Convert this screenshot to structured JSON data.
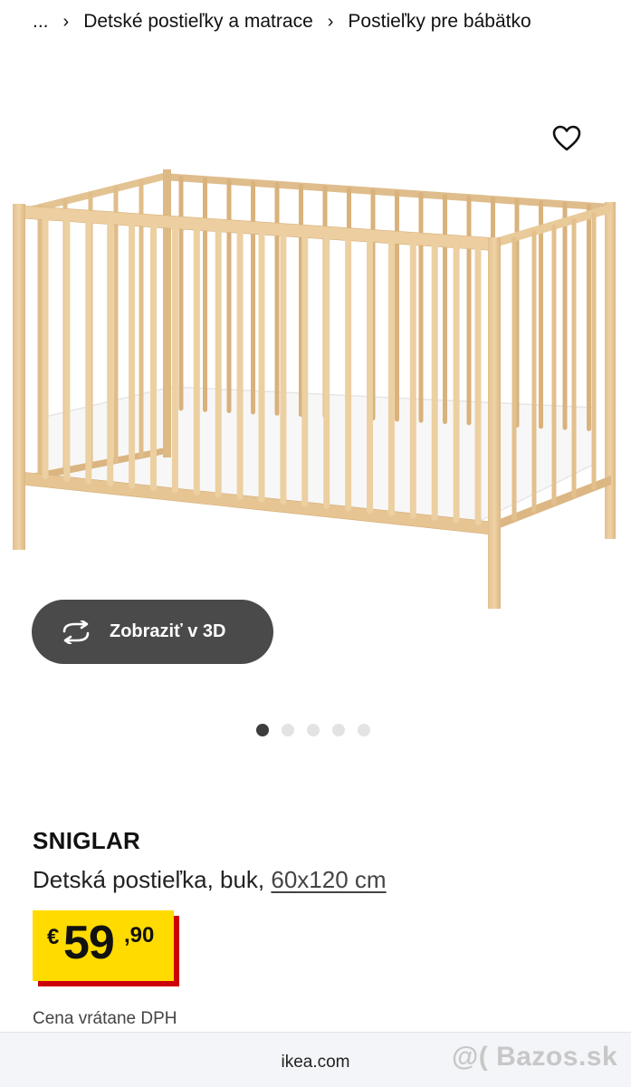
{
  "breadcrumb": {
    "items": [
      "...",
      "Detské postieľky a matrace",
      "Postieľky pre bábätko"
    ]
  },
  "view_3d": {
    "label": "Zobraziť v 3D"
  },
  "carousel": {
    "slides": 5,
    "active_index": 0
  },
  "product": {
    "name": "SNIGLAR",
    "description": "Detská postieľka, buk,",
    "size": "60x120 cm",
    "price": {
      "currency": "€",
      "integer": "59",
      "decimal": ",90"
    },
    "vat_note": "Cena vrátane DPH"
  },
  "browser": {
    "domain": "ikea.com"
  },
  "watermark": {
    "text": "@( Bazos.sk"
  },
  "colors": {
    "price_tag": "#ffdb00",
    "price_tag_shadow": "#cc0008",
    "button_3d": "#4a4a4a",
    "wood": "#e8c99a"
  },
  "icons": [
    "chevron-right-icon",
    "heart-icon",
    "rotate-3d-icon"
  ]
}
